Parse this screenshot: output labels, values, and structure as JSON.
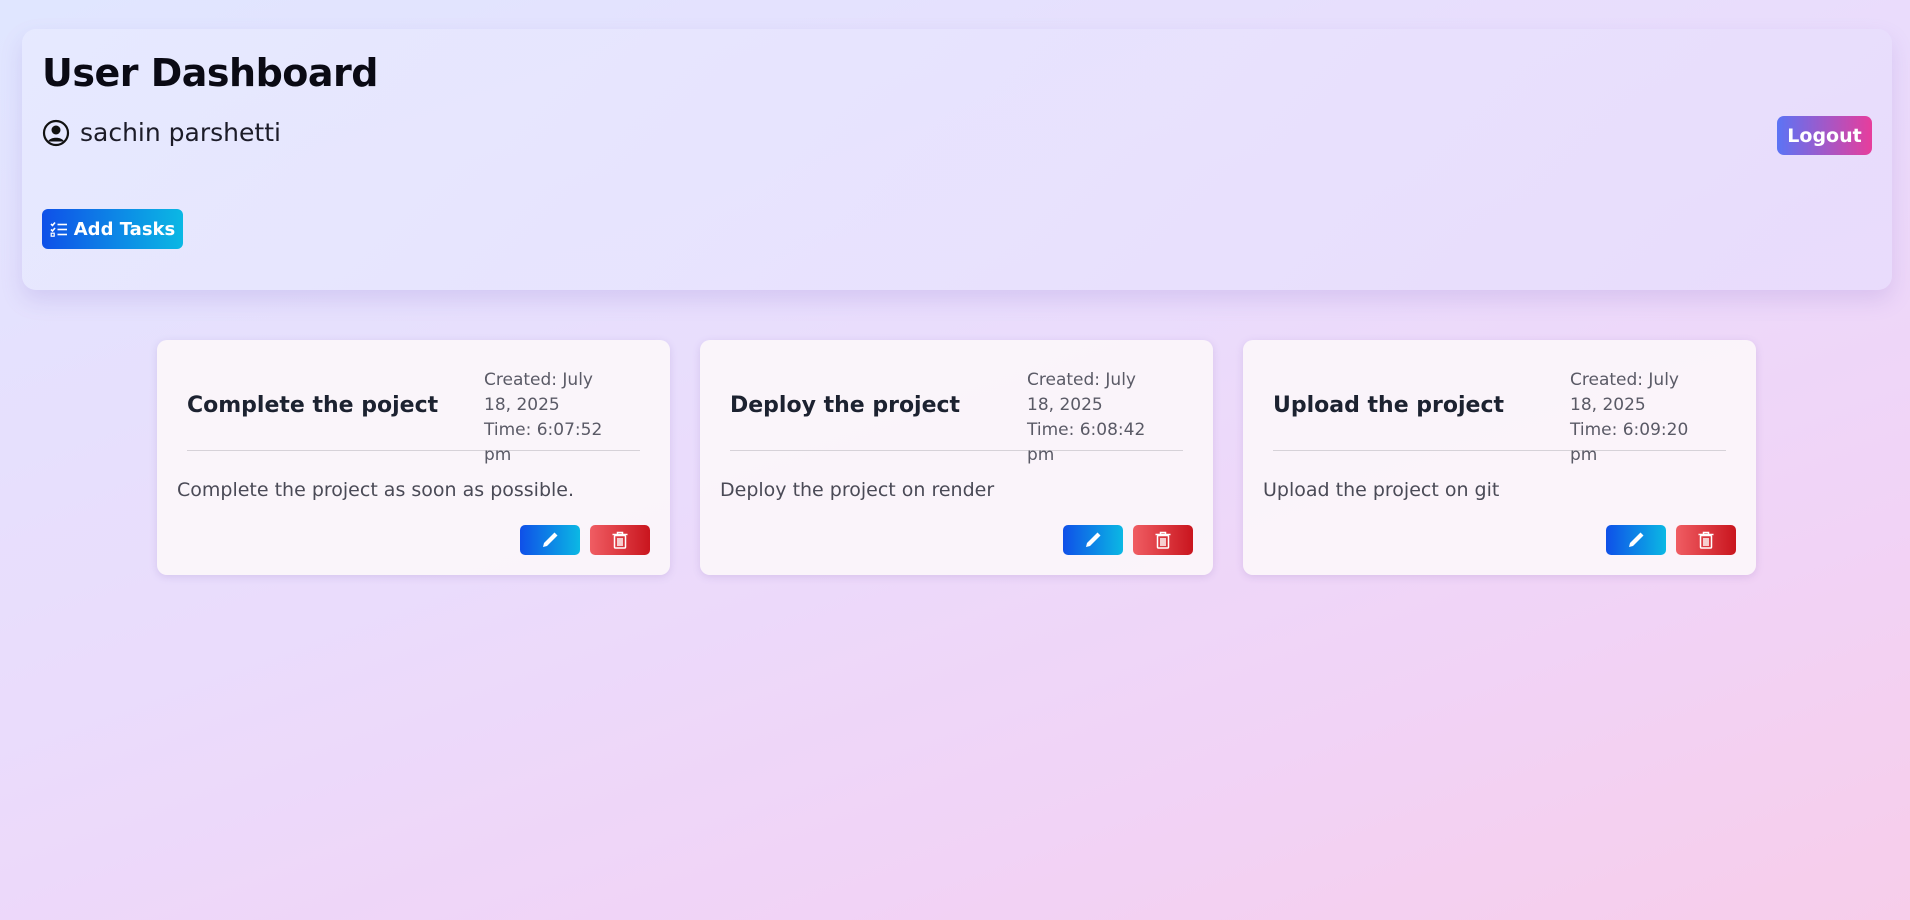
{
  "header": {
    "title": "User Dashboard",
    "user_name": "sachin parshetti",
    "logout_label": "Logout",
    "add_tasks_label": "Add Tasks"
  },
  "colors": {
    "primary_gradient": [
      "#0f50e8",
      "#0bb8e4"
    ],
    "logout_gradient": [
      "#5b74f5",
      "#e73d9c"
    ],
    "delete_gradient": [
      "#f05d63",
      "#c9151e"
    ]
  },
  "tasks": [
    {
      "title": "Complete the poject",
      "created": "Created: July 18, 2025",
      "time": "Time: 6:07:52 pm",
      "description": "Complete the project as soon as possible."
    },
    {
      "title": "Deploy the project",
      "created": "Created: July 18, 2025",
      "time": "Time: 6:08:42 pm",
      "description": "Deploy the project on render"
    },
    {
      "title": "Upload the project",
      "created": "Created: July 18, 2025",
      "time": "Time: 6:09:20 pm",
      "description": "Upload the project on git"
    }
  ]
}
